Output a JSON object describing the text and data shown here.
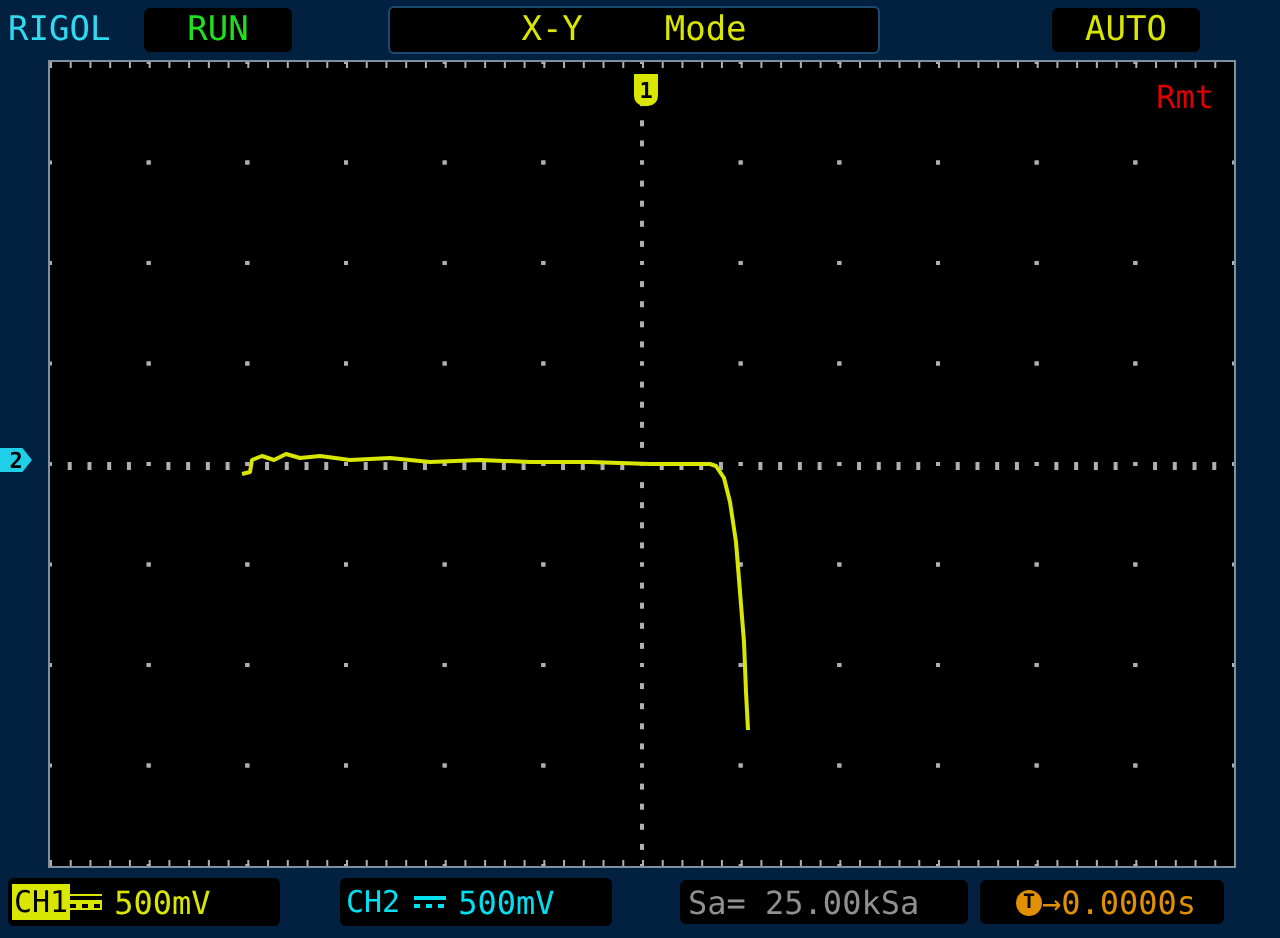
{
  "brand": "RIGOL",
  "run_state": "RUN",
  "mode": "X-Y    Mode",
  "trigger_mode": "AUTO",
  "remote": "Rmt",
  "trigger_marker": "1",
  "channel_marker": "2",
  "channels": [
    {
      "label": "CH1",
      "scale": "500mV",
      "selected": true,
      "color": "#d8e600"
    },
    {
      "label": "CH2",
      "scale": "500mV",
      "selected": false,
      "color": "#00e0f0"
    }
  ],
  "sample_rate": "Sa= 25.00kSa",
  "trigger": {
    "marker": "T",
    "offset": "→0.0000s"
  }
}
